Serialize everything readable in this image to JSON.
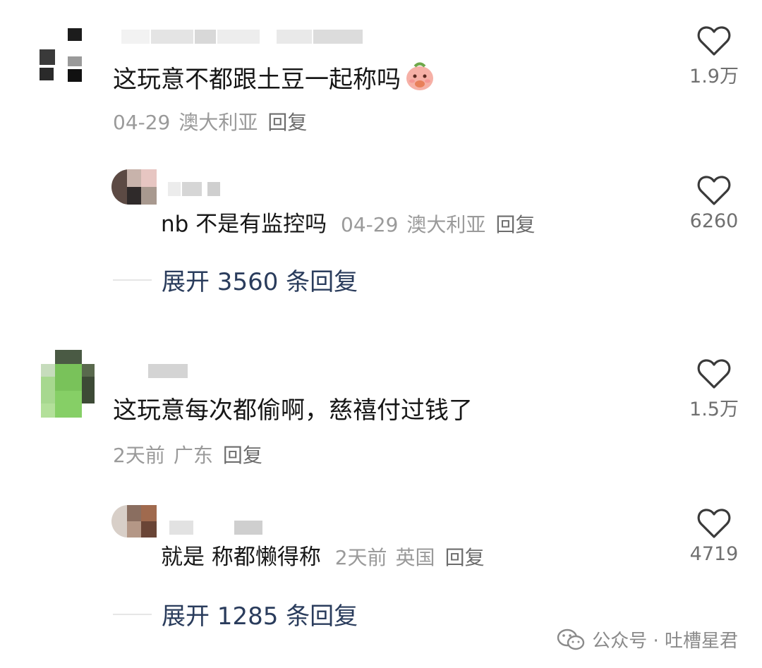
{
  "comments": [
    {
      "text": "这玩意不都跟土豆一起称吗",
      "date": "04-29",
      "location": "澳大利亚",
      "reply_label": "回复",
      "likes": "1.9万",
      "reply": {
        "text": "nb 不是有监控吗",
        "date": "04-29",
        "location": "澳大利亚",
        "reply_label": "回复",
        "likes": "6260"
      },
      "expand_label": "展开 3560 条回复"
    },
    {
      "text": "这玩意每次都偷啊，慈禧付过钱了",
      "date": "2天前",
      "location": "广东",
      "reply_label": "回复",
      "likes": "1.5万",
      "reply": {
        "text": "就是 称都懒得称",
        "date": "2天前",
        "location": "英国",
        "reply_label": "回复",
        "likes": "4719"
      },
      "expand_label": "展开 1285 条回复"
    }
  ],
  "watermark": {
    "icon": "wechat-icon",
    "text": "公众号 · 吐槽星君"
  },
  "colors": {
    "heart_stroke": "#3a3a3a",
    "meta_gray": "#9a9a9a",
    "expand_blue": "#2a3c5c"
  }
}
